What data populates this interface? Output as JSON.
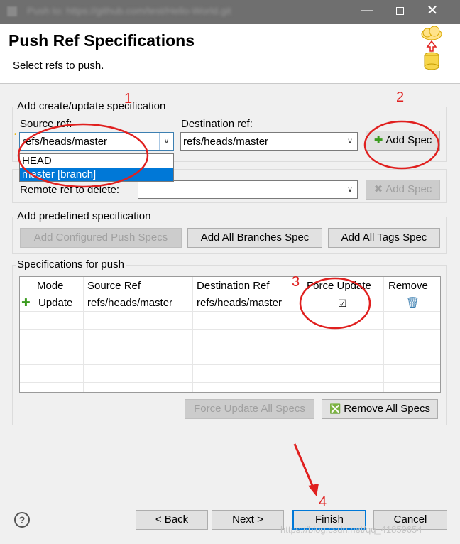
{
  "window": {
    "title": "Push to: https://github.com/test/Hello-World.git",
    "minimize_glyph": "—",
    "close_glyph": "✕"
  },
  "header": {
    "title": "Push Ref Specifications",
    "subtitle": "Select refs to push."
  },
  "create_group": {
    "legend": "Add create/update specification",
    "source_label": "Source ref:",
    "source_value": "refs/heads/master",
    "dest_label": "Destination ref:",
    "dest_value": "refs/heads/master",
    "add_spec_label": "Add Spec",
    "dropdown_options": [
      "HEAD",
      "master [branch]"
    ],
    "selected_option": "master [branch]"
  },
  "delete_group": {
    "remote_label": "Remote ref to delete:",
    "remote_value": "",
    "add_spec_label": "Add Spec"
  },
  "predefined_group": {
    "legend": "Add predefined specification",
    "configured_label": "Add Configured Push Specs",
    "branches_label": "Add All Branches Spec",
    "tags_label": "Add All Tags Spec"
  },
  "specs_group": {
    "legend": "Specifications for push",
    "columns": [
      "Mode",
      "Source Ref",
      "Destination Ref",
      "Force Update",
      "Remove"
    ],
    "rows": [
      {
        "mode": "Update",
        "source": "refs/heads/master",
        "dest": "refs/heads/master",
        "force": true
      }
    ],
    "force_all_label": "Force Update All Specs",
    "remove_all_label": "Remove All Specs"
  },
  "footer": {
    "help_glyph": "?",
    "back_label": "< Back",
    "next_label": "Next >",
    "finish_label": "Finish",
    "cancel_label": "Cancel"
  },
  "annotations": [
    "1",
    "2",
    "3",
    "4"
  ],
  "watermark": "https://blog.csdn.net/qq_41859654",
  "colors": {
    "annotation": "#e0201f",
    "selection": "#0078d7",
    "default_button_border": "#0078d7"
  }
}
